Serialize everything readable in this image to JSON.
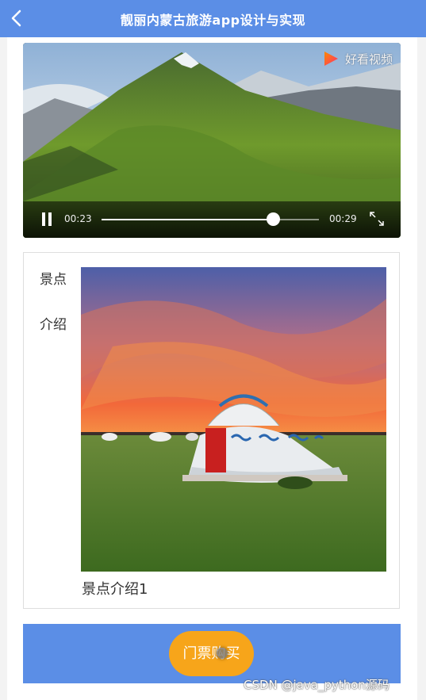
{
  "header": {
    "title": "靓丽内蒙古旅游app设计与实现",
    "back_icon": "chevron-left-icon"
  },
  "video": {
    "watermark_text": "好看视频",
    "current_time": "00:23",
    "total_time": "00:29",
    "progress": 0.79,
    "play_state_icon": "pause-icon",
    "fullscreen_icon": "fullscreen-icon"
  },
  "intro": {
    "side_label_line1": "景点",
    "side_label_line2": "介绍",
    "caption": "景点介绍1"
  },
  "bottom": {
    "buy_label": "门票购买"
  },
  "credit": "CSDN @java_python源码",
  "colors": {
    "header_bg": "#5b8ee6",
    "button_bg": "#f7a51a"
  }
}
